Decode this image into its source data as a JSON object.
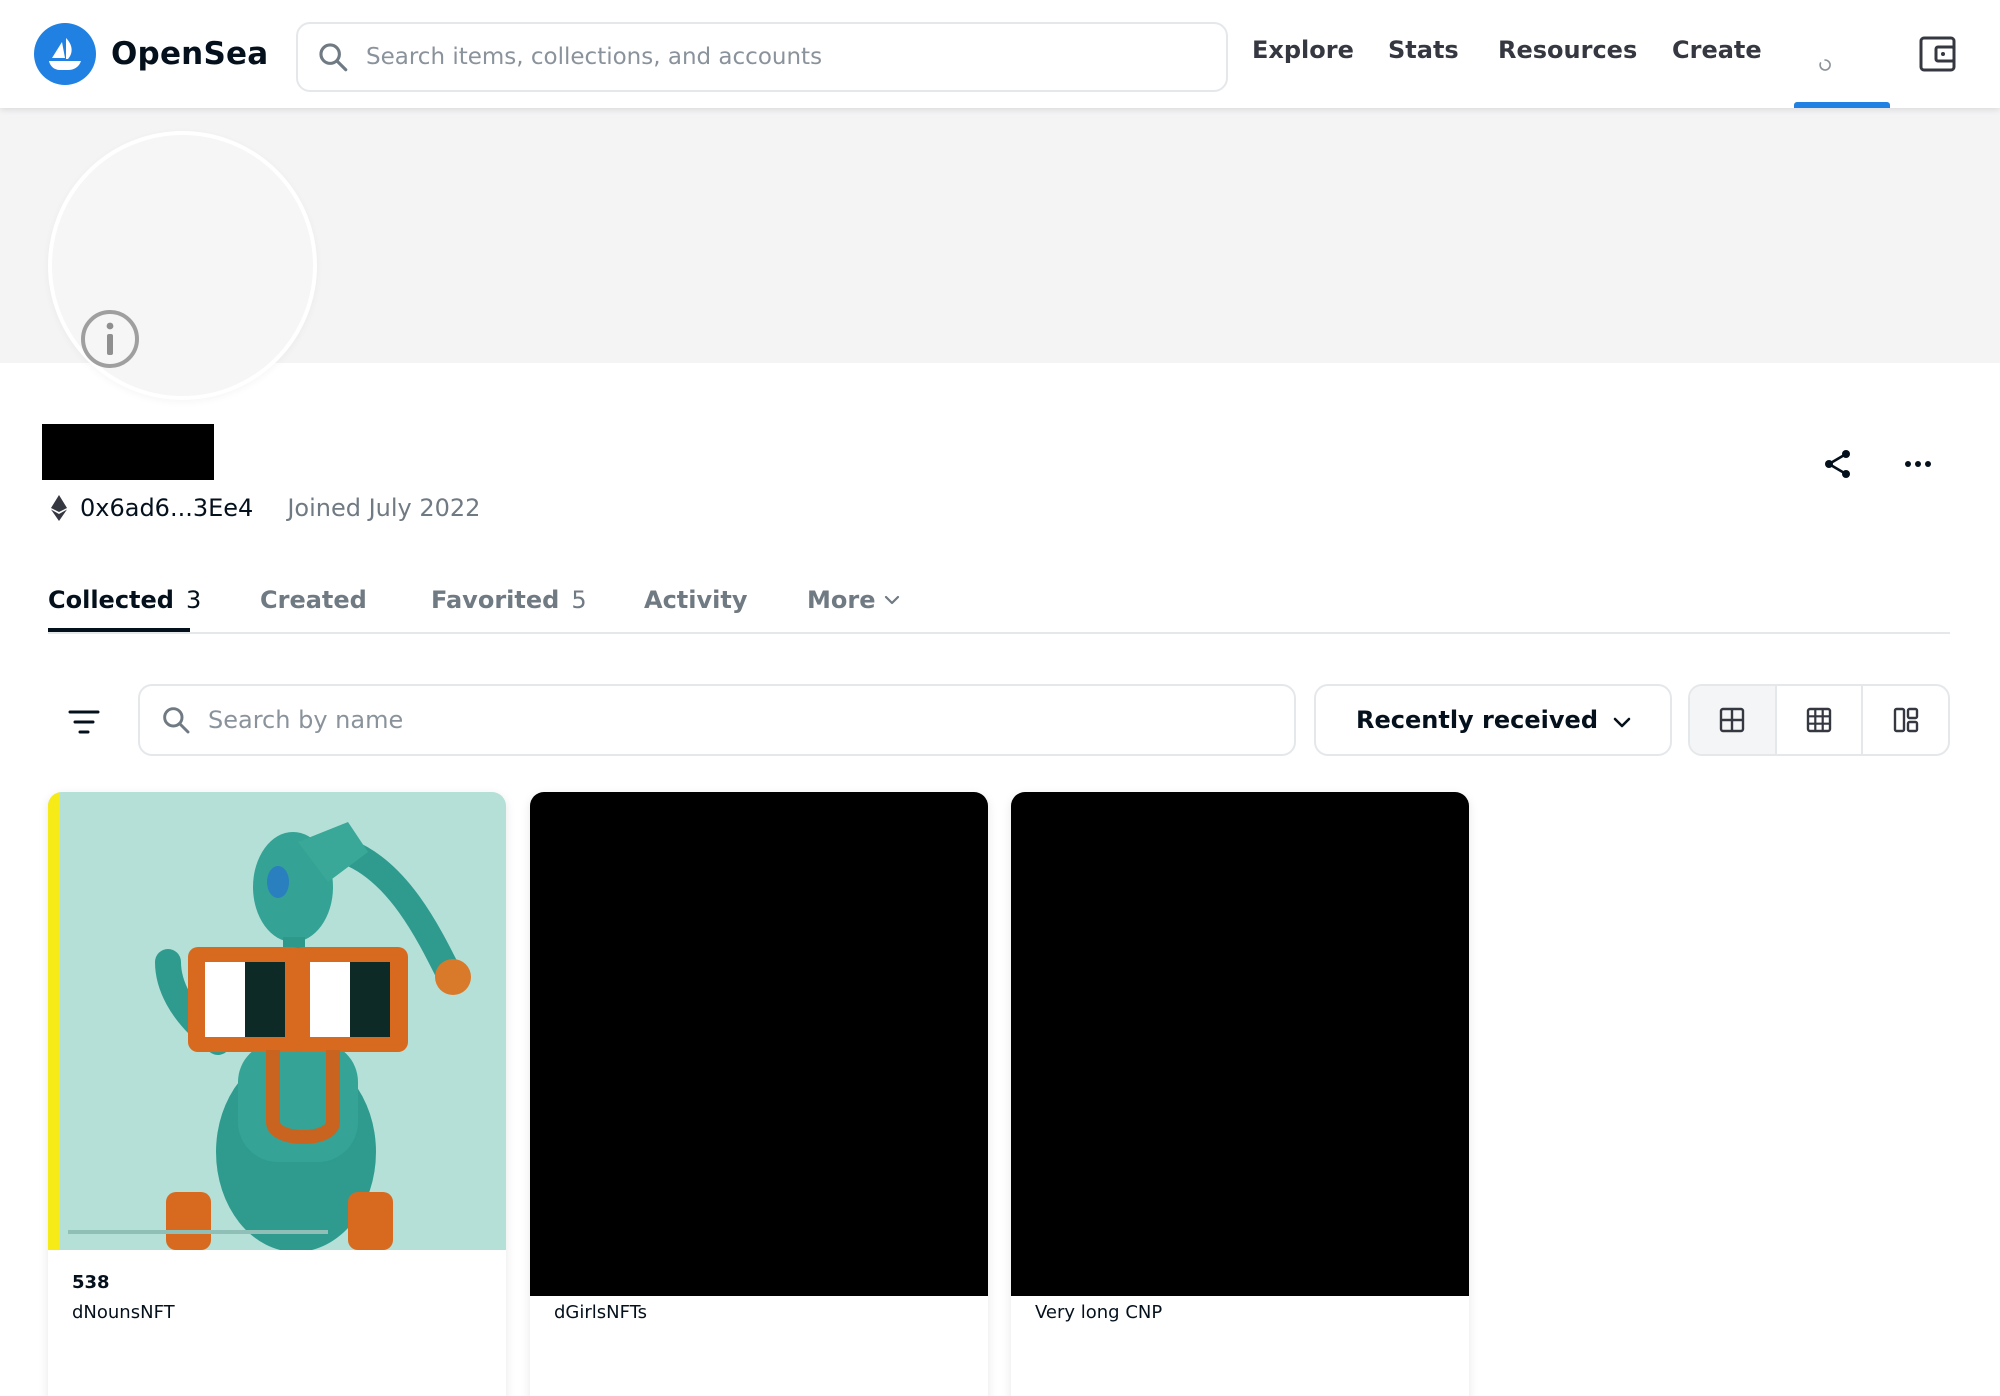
{
  "header": {
    "brand": "OpenSea",
    "search_placeholder": "Search items, collections, and accounts",
    "nav": [
      "Explore",
      "Stats",
      "Resources",
      "Create"
    ],
    "accent_color": "#2081e2"
  },
  "profile": {
    "address": "0x6ad6...3Ee4",
    "joined": "Joined July 2022"
  },
  "tabs": [
    {
      "label": "Collected",
      "count": "3"
    },
    {
      "label": "Created",
      "count": ""
    },
    {
      "label": "Favorited",
      "count": "5"
    },
    {
      "label": "Activity",
      "count": ""
    },
    {
      "label": "More",
      "count": ""
    }
  ],
  "filters": {
    "search_placeholder": "Search by name",
    "sort_label": "Recently received"
  },
  "cards": [
    {
      "token": "538",
      "collection": "dNounsNFT"
    },
    {
      "token": "",
      "collection": "dGirlsNFTs"
    },
    {
      "token": "",
      "collection": "Very long CNP"
    }
  ],
  "icons": {
    "search": "search-icon",
    "wallet": "wallet-icon",
    "share": "share-icon",
    "more": "more-horizontal-icon",
    "filter": "filter-icon",
    "eth": "ethereum-icon"
  }
}
